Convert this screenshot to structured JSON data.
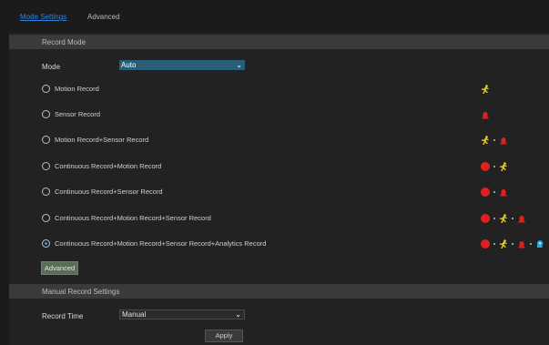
{
  "tabs": [
    {
      "label": "Mode Settings",
      "active": true
    },
    {
      "label": "Advanced",
      "active": false
    }
  ],
  "record_mode": {
    "header": "Record Mode",
    "mode_label": "Mode",
    "mode_value": "Auto",
    "options": [
      {
        "label": "Motion Record",
        "checked": false,
        "icons": [
          "motion"
        ]
      },
      {
        "label": "Sensor Record",
        "checked": false,
        "icons": [
          "sensor"
        ]
      },
      {
        "label": "Motion Record+Sensor Record",
        "checked": false,
        "icons": [
          "motion",
          "sensor"
        ]
      },
      {
        "label": "Continuous Record+Motion Record",
        "checked": false,
        "icons": [
          "continuous",
          "motion"
        ]
      },
      {
        "label": "Continuous Record+Sensor Record",
        "checked": false,
        "icons": [
          "continuous",
          "sensor"
        ]
      },
      {
        "label": "Continuous Record+Motion Record+Sensor Record",
        "checked": false,
        "icons": [
          "continuous",
          "motion",
          "sensor"
        ]
      },
      {
        "label": "Continuous Record+Motion Record+Sensor Record+Analytics Record",
        "checked": true,
        "icons": [
          "continuous",
          "motion",
          "sensor",
          "analytics"
        ]
      }
    ],
    "advanced_button": "Advanced"
  },
  "manual_record": {
    "header": "Manual Record Settings",
    "record_time_label": "Record Time",
    "record_time_value": "Manual"
  },
  "apply_button": "Apply",
  "colors": {
    "accent": "#2e82dd",
    "continuous": "#e02020",
    "motion": "#f2d31b",
    "sensor": "#e02020",
    "analytics": "#2aa8e0"
  }
}
